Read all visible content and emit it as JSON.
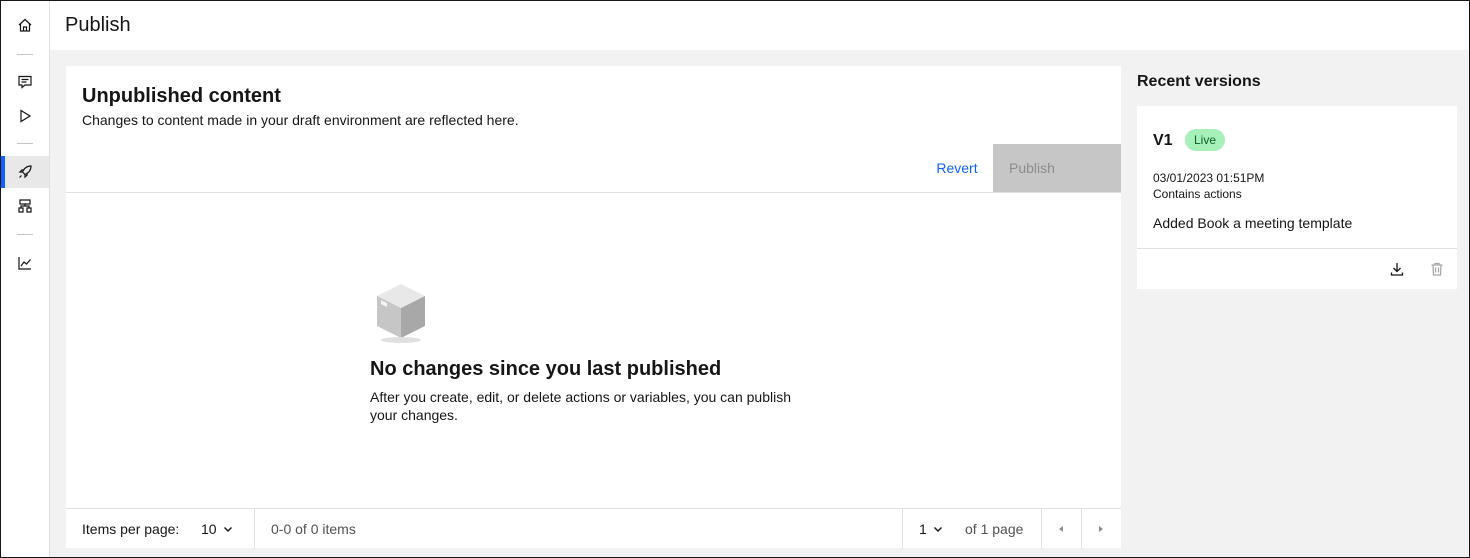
{
  "header": {
    "title": "Publish"
  },
  "rail": {
    "items": [
      {
        "icon": "home-icon"
      },
      {
        "icon": "chat-icon"
      },
      {
        "icon": "play-icon"
      },
      {
        "icon": "rocket-icon",
        "active": true
      },
      {
        "icon": "hierarchy-icon"
      },
      {
        "icon": "analytics-icon"
      }
    ]
  },
  "main": {
    "title": "Unpublished content",
    "subtitle": "Changes to content made in your draft environment are reflected here.",
    "revert_label": "Revert",
    "publish_label": "Publish",
    "empty": {
      "icon": "empty-box-icon",
      "title": "No changes since you last published",
      "description": "After you create, edit, or delete actions or variables, you can publish your changes."
    },
    "pagination": {
      "items_per_page_label": "Items per page:",
      "items_per_page_value": "10",
      "range_text": "0-0 of 0 items",
      "page_value": "1",
      "of_pages_text": "of 1 page"
    }
  },
  "recent": {
    "title": "Recent versions",
    "versions": [
      {
        "name": "V1",
        "badge": "Live",
        "date": "03/01/2023 01:51PM",
        "contains": "Contains actions",
        "description": "Added Book a meeting template"
      }
    ]
  },
  "colors": {
    "accent": "#0f62fe",
    "live_badge_bg": "#a7f0ba",
    "live_badge_text": "#0e6027",
    "disabled_button": "#c6c6c6"
  }
}
